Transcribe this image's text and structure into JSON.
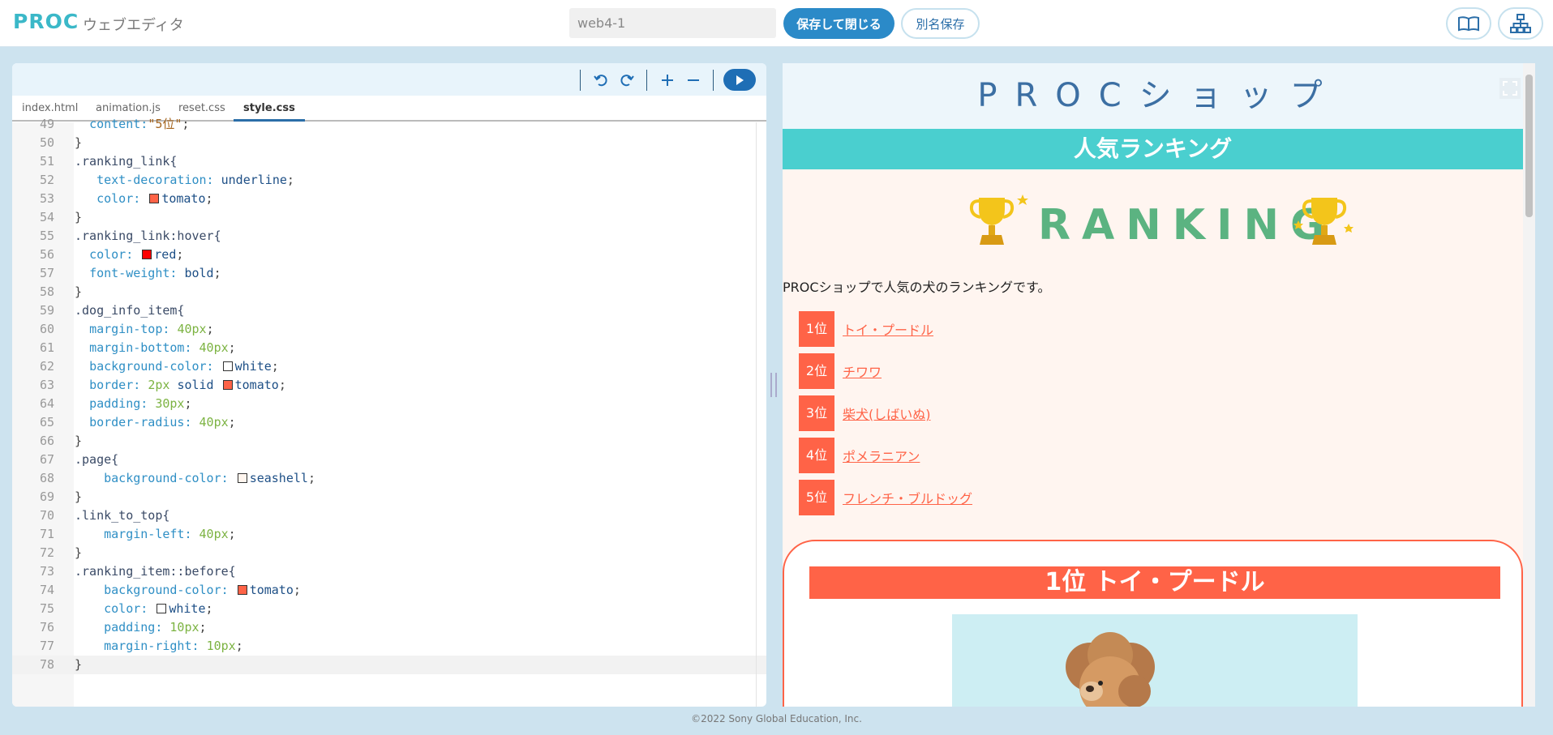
{
  "app": {
    "logo": "PROC",
    "name": "ウェブエディタ"
  },
  "header": {
    "project_name": "web4-1",
    "save_close_label": "保存して閉じる",
    "save_as_label": "別名保存"
  },
  "editor": {
    "tabs": [
      {
        "label": "index.html",
        "active": false
      },
      {
        "label": "animation.js",
        "active": false
      },
      {
        "label": "reset.css",
        "active": false
      },
      {
        "label": "style.css",
        "active": true
      }
    ],
    "lines": [
      {
        "n": "49",
        "html": "  <span class='prop'>content:</span><span class='str'>\"5位\"</span><span class='punc'>;</span>"
      },
      {
        "n": "50",
        "html": "<span class='punc'>}</span>"
      },
      {
        "n": "51",
        "html": "<span class='sel'>.ranking_link{</span>"
      },
      {
        "n": "52",
        "html": "   <span class='prop'>text-decoration:</span> <span class='val'>underline</span><span class='punc'>;</span>"
      },
      {
        "n": "53",
        "html": "   <span class='prop'>color:</span> <span class='sw' style='background:#ff6347'></span><span class='val'>tomato</span><span class='punc'>;</span>"
      },
      {
        "n": "54",
        "html": "<span class='punc'>}</span>"
      },
      {
        "n": "55",
        "html": "<span class='sel'>.ranking_link:hover{</span>"
      },
      {
        "n": "56",
        "html": "  <span class='prop'>color:</span> <span class='sw' style='background:#ff0000'></span><span class='val'>red</span><span class='punc'>;</span>"
      },
      {
        "n": "57",
        "html": "  <span class='prop'>font-weight:</span> <span class='val'>bold</span><span class='punc'>;</span>"
      },
      {
        "n": "58",
        "html": "<span class='punc'>}</span>"
      },
      {
        "n": "59",
        "html": "<span class='sel'>.dog_info_item{</span>"
      },
      {
        "n": "60",
        "html": "  <span class='prop'>margin-top:</span> <span class='num'>40px</span><span class='punc'>;</span>"
      },
      {
        "n": "61",
        "html": "  <span class='prop'>margin-bottom:</span> <span class='num'>40px</span><span class='punc'>;</span>"
      },
      {
        "n": "62",
        "html": "  <span class='prop'>background-color:</span> <span class='sw' style='background:#ffffff'></span><span class='val'>white</span><span class='punc'>;</span>"
      },
      {
        "n": "63",
        "html": "  <span class='prop'>border:</span> <span class='num'>2px</span> <span class='val'>solid</span> <span class='sw' style='background:#ff6347'></span><span class='val'>tomato</span><span class='punc'>;</span>"
      },
      {
        "n": "64",
        "html": "  <span class='prop'>padding:</span> <span class='num'>30px</span><span class='punc'>;</span>"
      },
      {
        "n": "65",
        "html": "  <span class='prop'>border-radius:</span> <span class='num'>40px</span><span class='punc'>;</span>"
      },
      {
        "n": "66",
        "html": "<span class='punc'>}</span>"
      },
      {
        "n": "67",
        "html": "<span class='sel'>.page{</span>"
      },
      {
        "n": "68",
        "html": "    <span class='prop'>background-color:</span> <span class='sw' style='background:#fff5ee'></span><span class='val'>seashell</span><span class='punc'>;</span>"
      },
      {
        "n": "69",
        "html": "<span class='punc'>}</span>"
      },
      {
        "n": "70",
        "html": "<span class='sel'>.link_to_top{</span>"
      },
      {
        "n": "71",
        "html": "    <span class='prop'>margin-left:</span> <span class='num'>40px</span><span class='punc'>;</span>"
      },
      {
        "n": "72",
        "html": "<span class='punc'>}</span>"
      },
      {
        "n": "73",
        "html": "<span class='sel'>.ranking_item::before{</span>"
      },
      {
        "n": "74",
        "html": "    <span class='prop'>background-color:</span> <span class='sw' style='background:#ff6347'></span><span class='val'>tomato</span><span class='punc'>;</span>"
      },
      {
        "n": "75",
        "html": "    <span class='prop'>color:</span> <span class='sw' style='background:#ffffff'></span><span class='val'>white</span><span class='punc'>;</span>"
      },
      {
        "n": "76",
        "html": "    <span class='prop'>padding:</span> <span class='num'>10px</span><span class='punc'>;</span>"
      },
      {
        "n": "77",
        "html": "    <span class='prop'>margin-right:</span> <span class='num'>10px</span><span class='punc'>;</span>"
      },
      {
        "n": "78",
        "html": "<span class='punc'>}</span>"
      }
    ]
  },
  "preview": {
    "shop_title": "PROCショップ",
    "band_title": "人気ランキング",
    "ranking_word": "RANKING",
    "intro": "PROCショップで人気の犬のランキングです。",
    "ranking": [
      {
        "badge": "1位",
        "name": "トイ・プードル"
      },
      {
        "badge": "2位",
        "name": "チワワ"
      },
      {
        "badge": "3位",
        "name": "柴犬(しばいぬ)"
      },
      {
        "badge": "4位",
        "name": "ポメラニアン"
      },
      {
        "badge": "5位",
        "name": "フレンチ・ブルドッグ"
      }
    ],
    "card_title": "1位 トイ・プードル"
  },
  "footer": {
    "copyright": "©2022 Sony Global Education, Inc."
  },
  "colors": {
    "accent": "#2b8ac8",
    "tomato": "#ff6347",
    "band": "#4acfcf",
    "ranking": "#5bb381"
  }
}
